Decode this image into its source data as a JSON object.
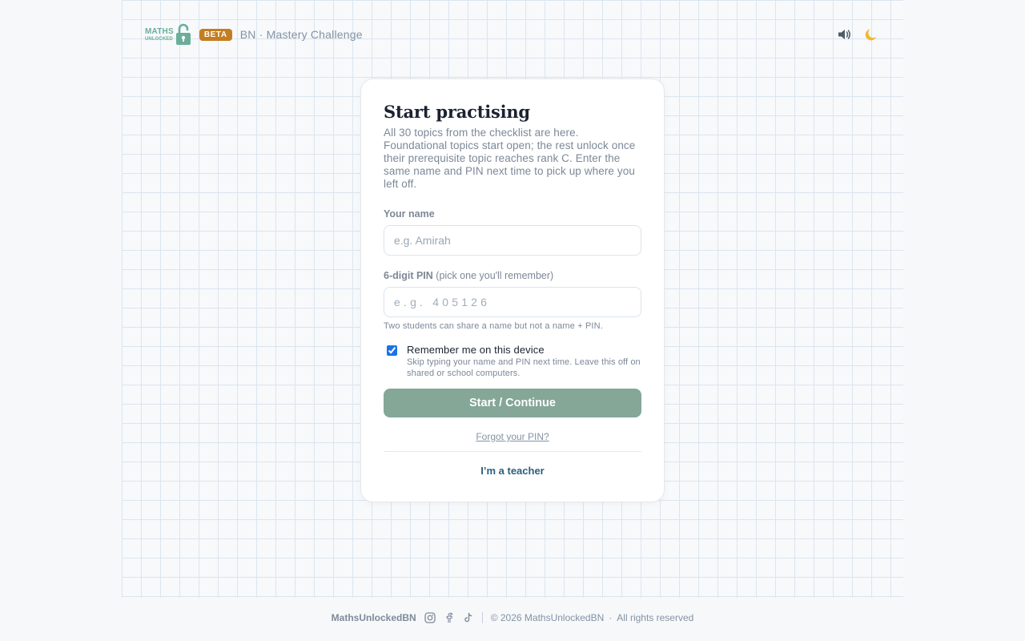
{
  "header": {
    "logo_line1": "MATHS",
    "logo_line2": "UNLOCKED",
    "beta_label": "BETA",
    "title": "BN · Mastery Challenge",
    "sound_icon": "speaker-icon",
    "theme_icon": "moon-icon"
  },
  "card": {
    "title": "Start practising",
    "intro": "All 30 topics from the checklist are here. Foundational topics start open; the rest unlock once their prerequisite topic reaches rank C. Enter the same name and PIN next time to pick up where you left off.",
    "name_label": "Your name",
    "name_placeholder": "e.g. Amirah",
    "name_value": "",
    "pin_label": "6-digit PIN",
    "pin_hint": "(pick one you'll remember)",
    "pin_placeholder": "e.g. 405126",
    "pin_value": "",
    "pin_note": "Two students can share a name but not a name + PIN.",
    "remember_label": "Remember me on this device",
    "remember_sub": "Skip typing your name and PIN next time. Leave this off on shared or school computers.",
    "remember_checked": true,
    "submit_label": "Start / Continue",
    "forgot_label": "Forgot your PIN?",
    "teacher_label": "I’m a teacher"
  },
  "footer": {
    "brand": "MathsUnlockedBN",
    "social_icons": [
      "instagram-icon",
      "facebook-icon",
      "tiktok-icon"
    ],
    "copyright": "© 2026 MathsUnlockedBN",
    "rights": "All rights reserved"
  },
  "colors": {
    "brand_green": "#6aae99",
    "beta_orange": "#c47d1f",
    "button_green": "#84a797",
    "teacher_link": "#2d5f7e",
    "grid_line": "#dbe5ef"
  }
}
